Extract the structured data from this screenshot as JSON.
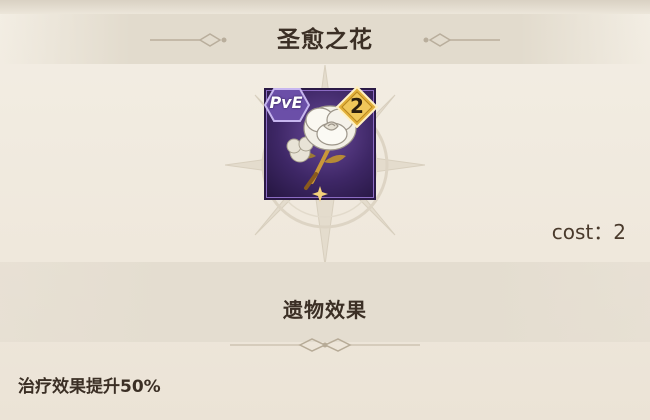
{
  "relic": {
    "name": "圣愈之花",
    "mode_badge": "PvE",
    "level_badge": "2",
    "cost_label": "cost：2",
    "icon": "white-flower-icon",
    "frame_color": "#3e2766",
    "badge_color": "#6b4fa8",
    "level_badge_color": "#e3b23c"
  },
  "effect_section": {
    "title": "遗物效果",
    "description": "治疗效果提升50%"
  }
}
